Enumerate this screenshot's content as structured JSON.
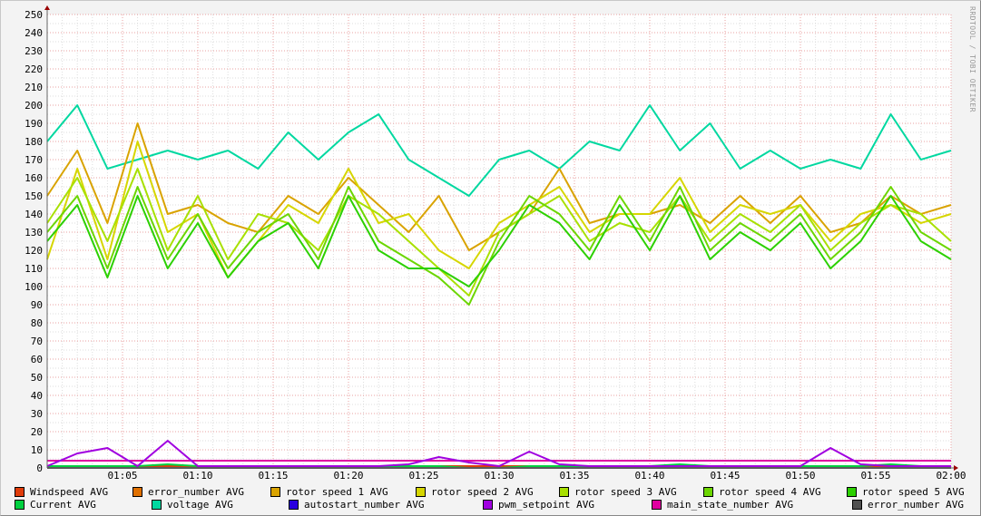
{
  "chart_data": {
    "type": "line",
    "title": "",
    "watermark": "RRDTOOL / TOBI OETIKER",
    "xlabel": "",
    "ylabel": "",
    "ylim": [
      0,
      250
    ],
    "y_ticks": [
      "0",
      "10",
      "20",
      "30",
      "40",
      "50",
      "60",
      "70",
      "80",
      "90",
      "100",
      "110",
      "120",
      "130",
      "140",
      "150",
      "160",
      "170",
      "180",
      "190",
      "200",
      "210",
      "220",
      "230",
      "240",
      "250"
    ],
    "x_ticks": [
      "01:05",
      "01:10",
      "01:15",
      "01:20",
      "01:25",
      "01:30",
      "01:35",
      "01:40",
      "01:45",
      "01:50",
      "01:55",
      "02:00"
    ],
    "x_minutes_range": [
      0,
      60
    ],
    "x_step_minutes": 2,
    "grid": true,
    "legend_placement": "bottom",
    "series": [
      {
        "name": "Windspeed AVG",
        "color": "#e03c0a",
        "values": [
          1,
          1,
          1,
          1,
          1,
          1,
          1,
          1,
          1,
          1,
          1,
          1,
          1,
          1,
          1,
          1,
          1,
          1,
          1,
          1,
          1,
          1,
          1,
          1,
          1,
          1,
          1,
          1,
          1,
          1,
          1
        ]
      },
      {
        "name": "error_number AVG",
        "color": "#e07000",
        "values": [
          0,
          0,
          0,
          0,
          0,
          0,
          0,
          0,
          0,
          0,
          0,
          0,
          0,
          0,
          0,
          0,
          0,
          0,
          0,
          0,
          0,
          0,
          0,
          0,
          0,
          0,
          0,
          0,
          0,
          0,
          0
        ]
      },
      {
        "name": "rotor speed 1 AVG",
        "color": "#d9a300",
        "values": [
          150,
          175,
          135,
          190,
          140,
          145,
          135,
          130,
          150,
          140,
          160,
          145,
          130,
          150,
          120,
          130,
          140,
          165,
          135,
          140,
          140,
          145,
          135,
          150,
          135,
          150,
          130,
          135,
          150,
          140,
          145
        ]
      },
      {
        "name": "rotor speed 2 AVG",
        "color": "#d6d600",
        "values": [
          115,
          165,
          115,
          180,
          130,
          140,
          105,
          125,
          145,
          135,
          165,
          135,
          140,
          120,
          110,
          135,
          145,
          155,
          130,
          140,
          140,
          160,
          130,
          145,
          140,
          145,
          125,
          140,
          145,
          135,
          140
        ]
      },
      {
        "name": "rotor speed 3 AVG",
        "color": "#a8e000",
        "values": [
          135,
          160,
          125,
          165,
          120,
          150,
          115,
          140,
          135,
          120,
          150,
          140,
          125,
          110,
          95,
          130,
          140,
          150,
          125,
          135,
          130,
          150,
          125,
          140,
          130,
          145,
          120,
          135,
          145,
          140,
          125
        ]
      },
      {
        "name": "rotor speed 4 AVG",
        "color": "#6cd600",
        "values": [
          130,
          150,
          110,
          155,
          115,
          140,
          110,
          130,
          140,
          115,
          155,
          125,
          115,
          105,
          90,
          125,
          150,
          140,
          120,
          150,
          125,
          155,
          120,
          135,
          125,
          140,
          115,
          130,
          155,
          130,
          120
        ]
      },
      {
        "name": "rotor speed 5 AVG",
        "color": "#2cd000",
        "values": [
          125,
          145,
          105,
          150,
          110,
          135,
          105,
          125,
          135,
          110,
          150,
          120,
          110,
          110,
          100,
          120,
          145,
          135,
          115,
          145,
          120,
          150,
          115,
          130,
          120,
          135,
          110,
          125,
          150,
          125,
          115
        ]
      },
      {
        "name": "Current AVG",
        "color": "#00d040",
        "values": [
          1,
          1,
          1,
          1,
          2,
          1,
          1,
          0,
          1,
          1,
          1,
          1,
          1,
          1,
          0,
          0,
          1,
          1,
          1,
          1,
          1,
          2,
          1,
          0,
          1,
          1,
          1,
          1,
          2,
          1,
          1
        ]
      },
      {
        "name": "voltage AVG",
        "color": "#00d8a0",
        "values": [
          180,
          200,
          165,
          170,
          175,
          170,
          175,
          165,
          185,
          170,
          185,
          195,
          170,
          160,
          150,
          170,
          175,
          165,
          180,
          175,
          200,
          175,
          190,
          165,
          175,
          165,
          170,
          165,
          195,
          170,
          175
        ]
      },
      {
        "name": "autostart_number AVG",
        "color": "#2800e0",
        "values": [
          0,
          0,
          0,
          0,
          0,
          0,
          0,
          0,
          0,
          0,
          0,
          0,
          0,
          0,
          0,
          0,
          0,
          0,
          0,
          0,
          0,
          0,
          0,
          0,
          0,
          0,
          0,
          0,
          0,
          0,
          0
        ]
      },
      {
        "name": "pwm_setpoint AVG",
        "color": "#a000e0",
        "values": [
          1,
          8,
          11,
          1,
          15,
          1,
          1,
          1,
          1,
          1,
          1,
          1,
          2,
          6,
          3,
          1,
          9,
          2,
          1,
          1,
          1,
          1,
          1,
          1,
          1,
          1,
          11,
          2,
          1,
          1,
          1
        ]
      },
      {
        "name": "main_state_number AVG",
        "color": "#e000a0",
        "values": [
          4,
          4,
          4,
          4,
          4,
          4,
          4,
          4,
          4,
          4,
          4,
          4,
          4,
          4,
          4,
          4,
          4,
          4,
          4,
          4,
          4,
          4,
          4,
          4,
          4,
          4,
          4,
          4,
          4,
          4,
          4
        ]
      },
      {
        "name": "error_number AVG",
        "color": "#505050",
        "values": [
          0,
          0,
          0,
          0,
          0,
          0,
          0,
          0,
          0,
          0,
          0,
          0,
          0,
          0,
          0,
          0,
          0,
          0,
          0,
          0,
          0,
          0,
          0,
          0,
          0,
          0,
          0,
          0,
          0,
          0,
          0
        ]
      }
    ]
  }
}
